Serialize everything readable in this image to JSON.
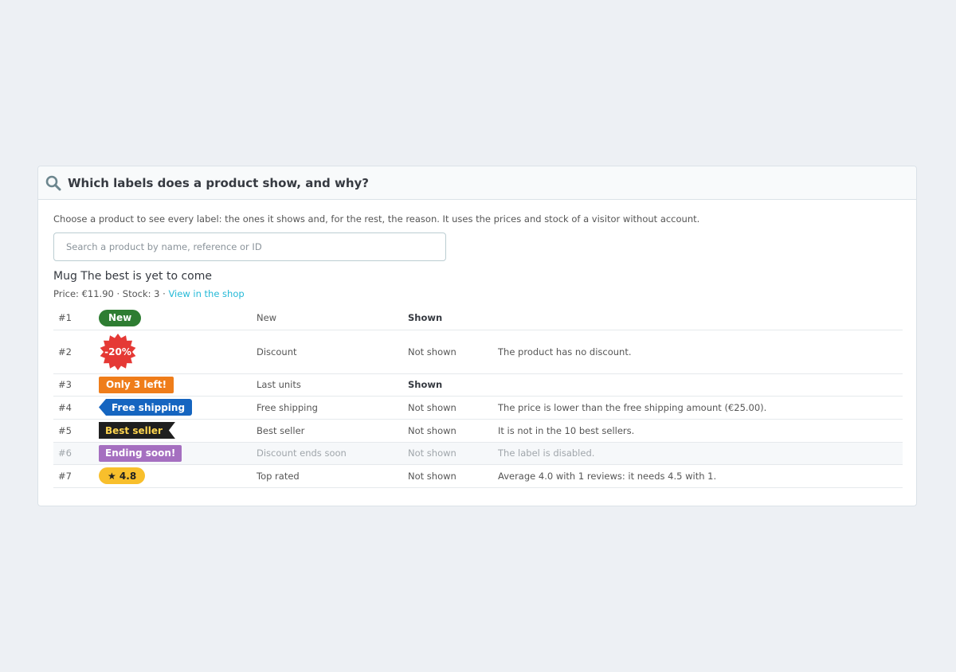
{
  "panel": {
    "title": "Which labels does a product show, and why?",
    "icon": "search-icon",
    "intro": "Choose a product to see every label: the ones it shows and, for the rest, the reason. It uses the prices and stock of a visitor without account."
  },
  "search": {
    "placeholder": "Search a product by name, reference or ID",
    "value": ""
  },
  "product": {
    "name": "Mug The best is yet to come",
    "price_text": "Price: €11.90 · Stock: 3 · ",
    "shop_link": "View in the shop"
  },
  "labels": [
    {
      "num": "#1",
      "badge": "New",
      "type": "New",
      "status": "Shown",
      "reason": "",
      "color": "#2e7d32"
    },
    {
      "num": "#2",
      "badge": "-20%",
      "type": "Discount",
      "status": "Not shown",
      "reason": "The product has no discount.",
      "color": "#e53935"
    },
    {
      "num": "#3",
      "badge": "Only 3 left!",
      "type": "Last units",
      "status": "Shown",
      "reason": "",
      "color": "#ef7d1a"
    },
    {
      "num": "#4",
      "badge": "Free shipping",
      "type": "Free shipping",
      "status": "Not shown",
      "reason": "The price is lower than the free shipping amount (€25.00).",
      "color": "#1565c0"
    },
    {
      "num": "#5",
      "badge": "Best seller",
      "type": "Best seller",
      "status": "Not shown",
      "reason": "It is not in the 10 best sellers.",
      "color": "#1f1f1f"
    },
    {
      "num": "#6",
      "badge": "Ending soon!",
      "type": "Discount ends soon",
      "status": "Not shown",
      "reason": "The label is disabled.",
      "color": "#a56fc0",
      "disabled": true
    },
    {
      "num": "#7",
      "badge": "★ 4.8",
      "type": "Top rated",
      "status": "Not shown",
      "reason": "Average 4.0 with 1 reviews: it needs 4.5 with 1.",
      "color": "#f8bf2c"
    }
  ]
}
